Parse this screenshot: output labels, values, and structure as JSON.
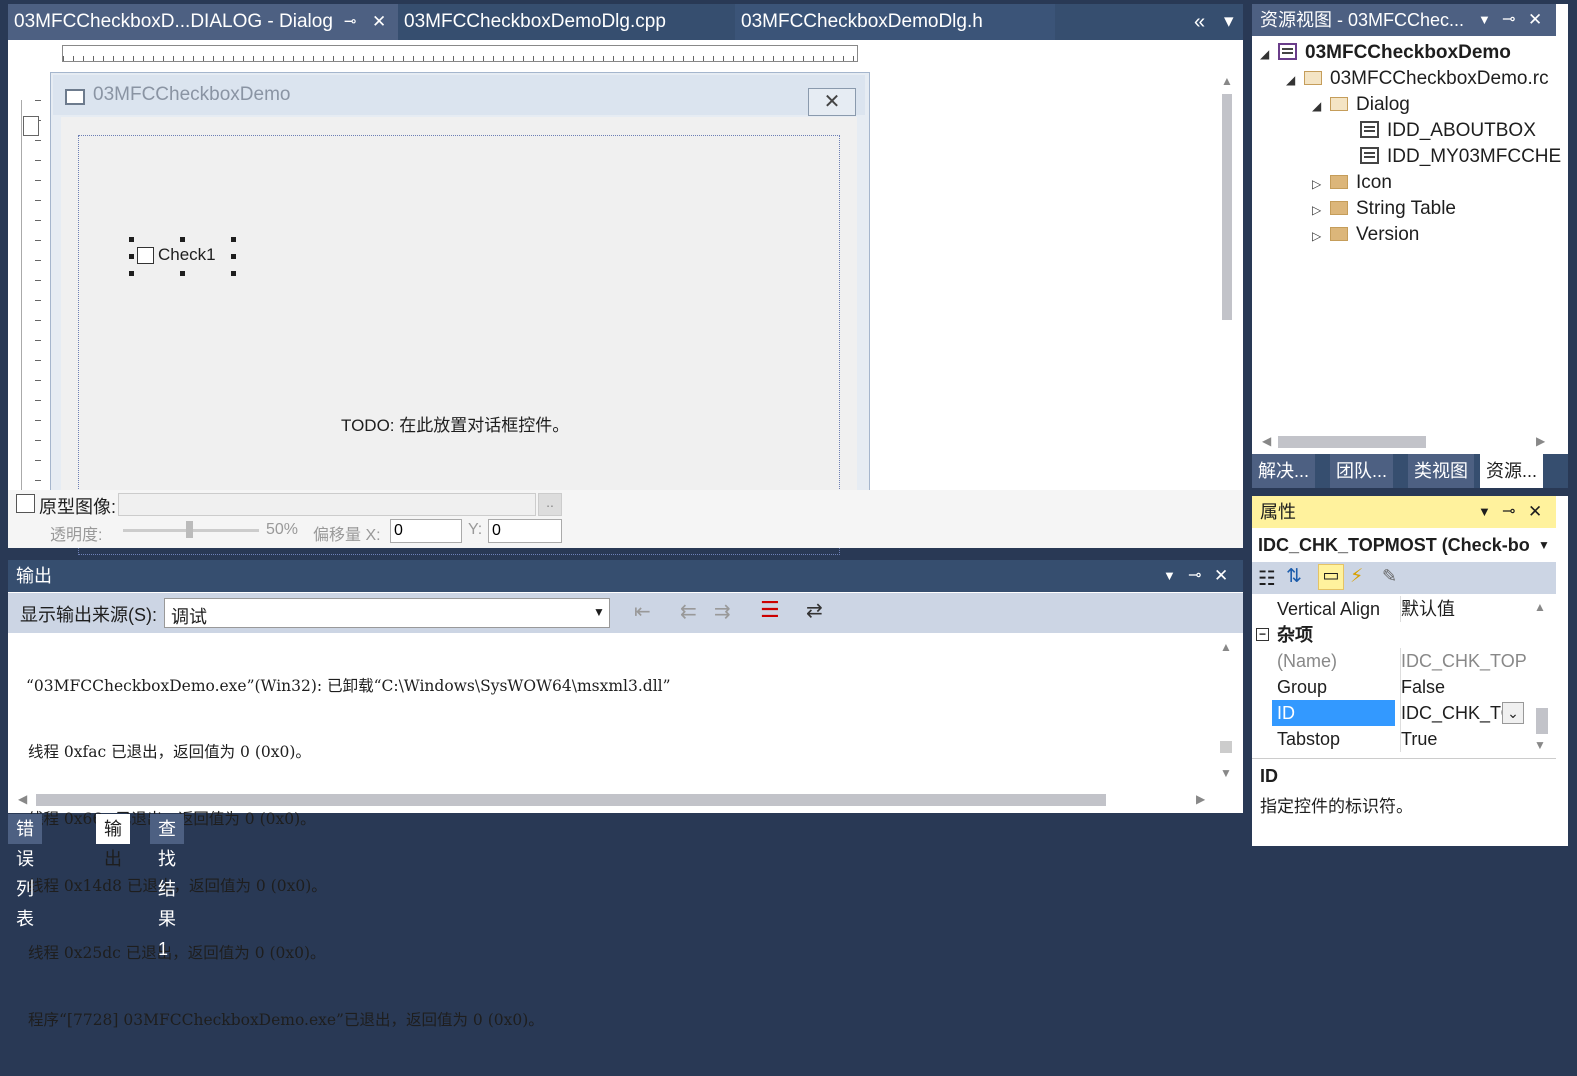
{
  "tabs": [
    {
      "label": "03MFCCheckboxD...DIALOG - Dialog",
      "pin": "⊸",
      "close": "✕"
    },
    {
      "label": "03MFCCheckboxDemoDlg.cpp"
    },
    {
      "label": "03MFCCheckboxDemoDlg.h"
    }
  ],
  "tab_controls": {
    "overflow": "«",
    "dropdown": "▾"
  },
  "dialog": {
    "title": "03MFCCheckboxDemo",
    "checkbox_label": "Check1",
    "todo_text": "TODO: 在此放置对话框控件。"
  },
  "prototype": {
    "label": "原型图像:",
    "browse": "..",
    "transparency_label": "透明度:",
    "transparency_value": "50%",
    "offset_x_label": "偏移量 X:",
    "offset_x": "0",
    "offset_y_label": "Y:",
    "offset_y": "0"
  },
  "output": {
    "title": "输出",
    "source_label": "显示输出来源(S):",
    "source_value": "调试",
    "lines": [
      "“03MFCCheckboxDemo.exe”(Win32): 已卸载“C:\\Windows\\SysWOW64\\msxml3.dll”",
      "线程 0xfac 已退出，返回值为 0 (0x0)。",
      "线程 0x66c 已退出，返回值为 0 (0x0)。",
      "线程 0x14d8 已退出，返回值为 0 (0x0)。",
      "线程 0x25dc 已退出，返回值为 0 (0x0)。",
      "程序“[7728] 03MFCCheckboxDemo.exe”已退出，返回值为 0 (0x0)。"
    ]
  },
  "bottom_tabs": [
    "错误列表",
    "输出",
    "查找结果 1"
  ],
  "resource_view": {
    "title": "资源视图 - 03MFCChec...",
    "tree": [
      {
        "label": "03MFCCheckboxDemo"
      },
      {
        "label": "03MFCCheckboxDemo.rc"
      },
      {
        "label": "Dialog"
      },
      {
        "label": "IDD_ABOUTBOX"
      },
      {
        "label": "IDD_MY03MFCCHE"
      },
      {
        "label": "Icon"
      },
      {
        "label": "String Table"
      },
      {
        "label": "Version"
      }
    ],
    "tabs": [
      "解决...",
      "团队...",
      "类视图",
      "资源..."
    ]
  },
  "properties": {
    "title": "属性",
    "object": "IDC_CHK_TOPMOST (Check-bo",
    "rows": [
      {
        "key": "Vertical Align",
        "value": "默认值"
      },
      {
        "key": "(Name)",
        "value": "IDC_CHK_TOPM"
      },
      {
        "key": "Group",
        "value": "False"
      },
      {
        "key": "ID",
        "value": "IDC_CHK_TO"
      },
      {
        "key": "Tabstop",
        "value": "True"
      }
    ],
    "category": "杂项",
    "desc_title": "ID",
    "desc_text": "指定控件的标识符。"
  }
}
